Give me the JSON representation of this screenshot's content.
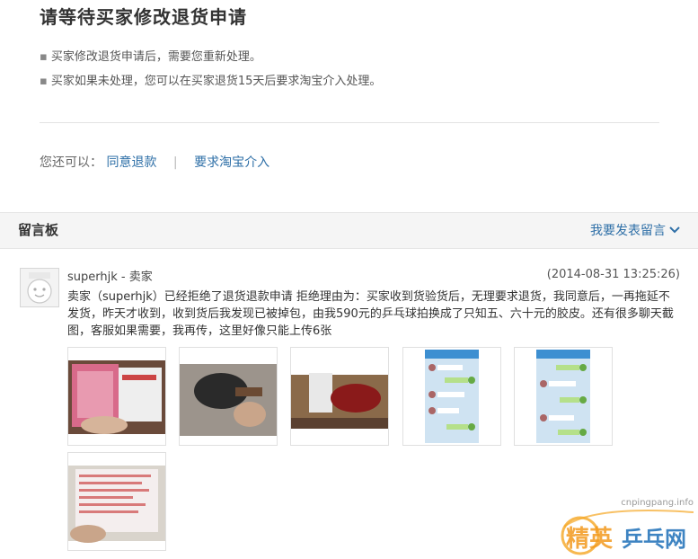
{
  "header": {
    "title": "请等待买家修改退货申请"
  },
  "notes": [
    "买家修改退货申请后，需要您重新处理。",
    "买家如果未处理，您可以在买家退货15天后要求淘宝介入处理。"
  ],
  "actions": {
    "prefix": "您还可以：",
    "agree_refund": "同意退款",
    "separator": "|",
    "request_taobao": "要求淘宝介入"
  },
  "board": {
    "title": "留言板",
    "post_link": "我要发表留言"
  },
  "message": {
    "author": "superhjk - 卖家",
    "time": "(2014-08-31 13:25:26)",
    "content": "卖家（superhjk）已经拒绝了退货退款申请 拒绝理由为：买家收到货验货后，无理要求退货，我同意后，一再拖延不发货，昨天才收到，收到货后我发现已被掉包，由我590元的乒乓球拍换成了只知五、六十元的胶皮。还有很多聊天截图，客服如果需要，我再传，这里好像只能上传6张"
  },
  "thumbnails": [
    "photo-rubber-package",
    "photo-racket-blade",
    "photo-racket-box",
    "photo-chat-screenshot-1",
    "photo-chat-screenshot-2",
    "photo-receipt"
  ],
  "watermark": {
    "url": "cnpingpang.info",
    "logo_text": "精英乒乓网"
  },
  "colors": {
    "link": "#2e6fa7",
    "header_bg": "#f5f5f5",
    "text": "#333333"
  }
}
